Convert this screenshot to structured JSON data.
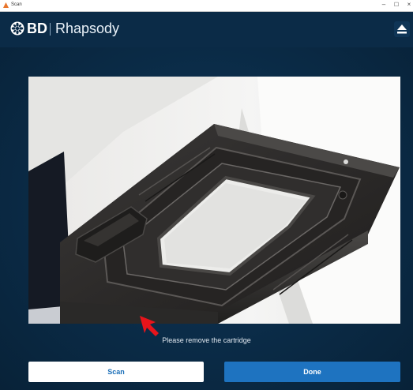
{
  "window": {
    "title": "Scan",
    "controls": {
      "minimize": "–",
      "maximize": "☐",
      "close": "×"
    }
  },
  "header": {
    "brand": "BD",
    "product": "Rhapsody",
    "logo_icon": "bd-logo-icon",
    "eject_icon": "eject-icon"
  },
  "main": {
    "image_alt": "cartridge-tray-photo",
    "status_text": "Please remove the cartridge"
  },
  "buttons": {
    "scan_label": "Scan",
    "done_label": "Done"
  },
  "colors": {
    "header_bg": "#0b2b47",
    "accent": "#1e73c0",
    "cursor": "#e8141b"
  }
}
